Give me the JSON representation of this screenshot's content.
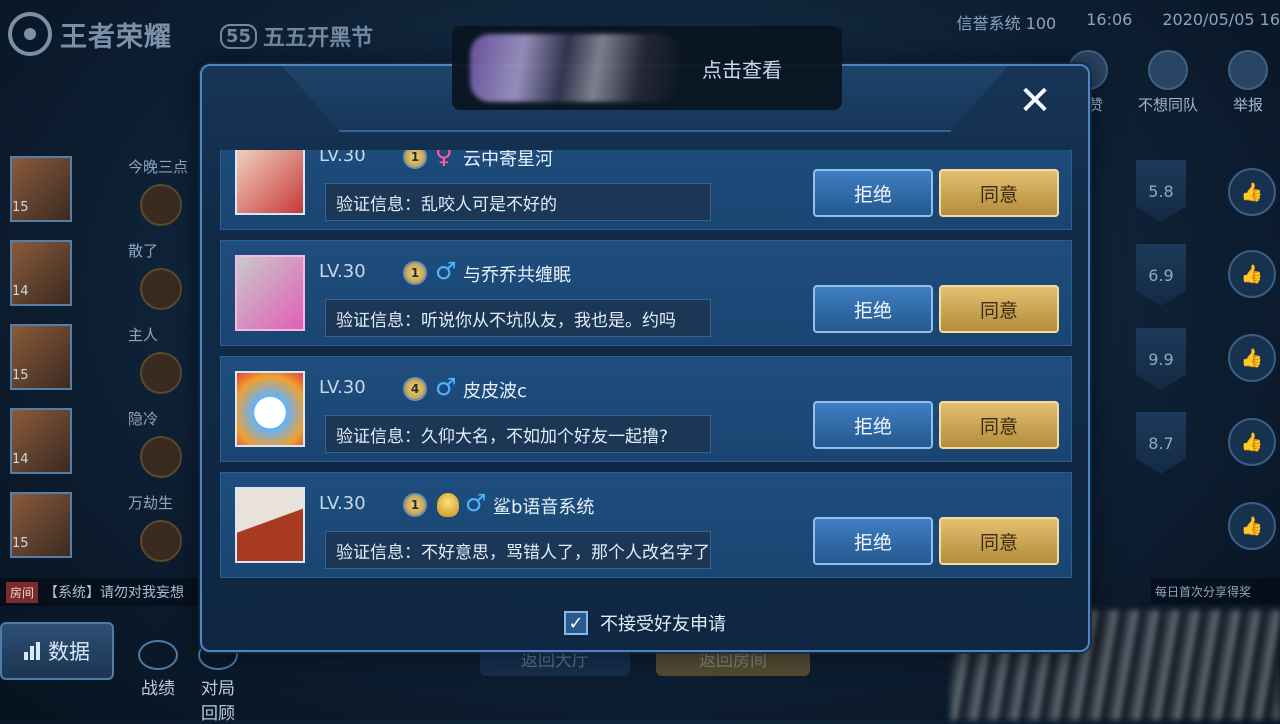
{
  "top": {
    "logo_text": "王者荣耀",
    "festival_badge": "55",
    "festival_text": "五五开黑节",
    "credit": "信誉系统 100",
    "time": "16:06",
    "date": "2020/05/05 16"
  },
  "bg_actions": [
    {
      "label": "点赞",
      "icon": "thumbs-up-icon"
    },
    {
      "label": "不想同队",
      "icon": "person-block-icon"
    },
    {
      "label": "举报",
      "icon": "warning-icon"
    }
  ],
  "left_list": [
    {
      "name": "今晚三点",
      "level": "15"
    },
    {
      "name": "散了",
      "level": "14"
    },
    {
      "name": "主人",
      "level": "15"
    },
    {
      "name": "隐冷",
      "level": "14"
    },
    {
      "name": "万劫生",
      "level": "15"
    }
  ],
  "right_scores": [
    "5.8",
    "6.9",
    "9.9",
    "8.7"
  ],
  "system_msg": {
    "tag": "房间",
    "text": "【系统】请勿对我妄想"
  },
  "share_msg": "每日首次分享得奖",
  "bottom": {
    "data_label": "数据",
    "record_label": "战绩",
    "review_label": "对局回顾",
    "back_lobby": "返回大厅",
    "back_room": "返回房间"
  },
  "modal": {
    "tooltip_text": "点击查看",
    "close_icon": "✕",
    "reject_label": "拒绝",
    "accept_label": "同意",
    "verify_prefix": "验证信息：",
    "requests": [
      {
        "level": "LV.30",
        "rank": "1",
        "gender": "♀",
        "gender_type": "f",
        "nickname": "云中寄星河",
        "message": "乱咬人可是不好的",
        "avatar_colors": [
          "#f4d9c6",
          "#c43a3a"
        ]
      },
      {
        "level": "LV.30",
        "rank": "1",
        "gender": "♂",
        "gender_type": "m",
        "nickname": "与乔乔共缠眠",
        "message": "听说你从不坑队友，我也是。约吗",
        "avatar_colors": [
          "#c9c9c9",
          "#e05fb8"
        ]
      },
      {
        "level": "LV.30",
        "rank": "4",
        "gender": "♂",
        "gender_type": "m",
        "nickname": "皮皮波c",
        "message": "久仰大名，不如加个好友一起撸?",
        "avatar_colors": [
          "#ffffff",
          "#5fb3ff"
        ]
      },
      {
        "level": "LV.30",
        "rank": "1",
        "gender": "♂",
        "gender_type": "m",
        "nickname": "鲨b语音系统",
        "message": "不好意思，骂错人了，那个人改名字了",
        "avatar_colors": [
          "#e8e2da",
          "#a83a22"
        ]
      }
    ],
    "checkbox_label": "不接受好友申请",
    "checkbox_checked": true
  }
}
